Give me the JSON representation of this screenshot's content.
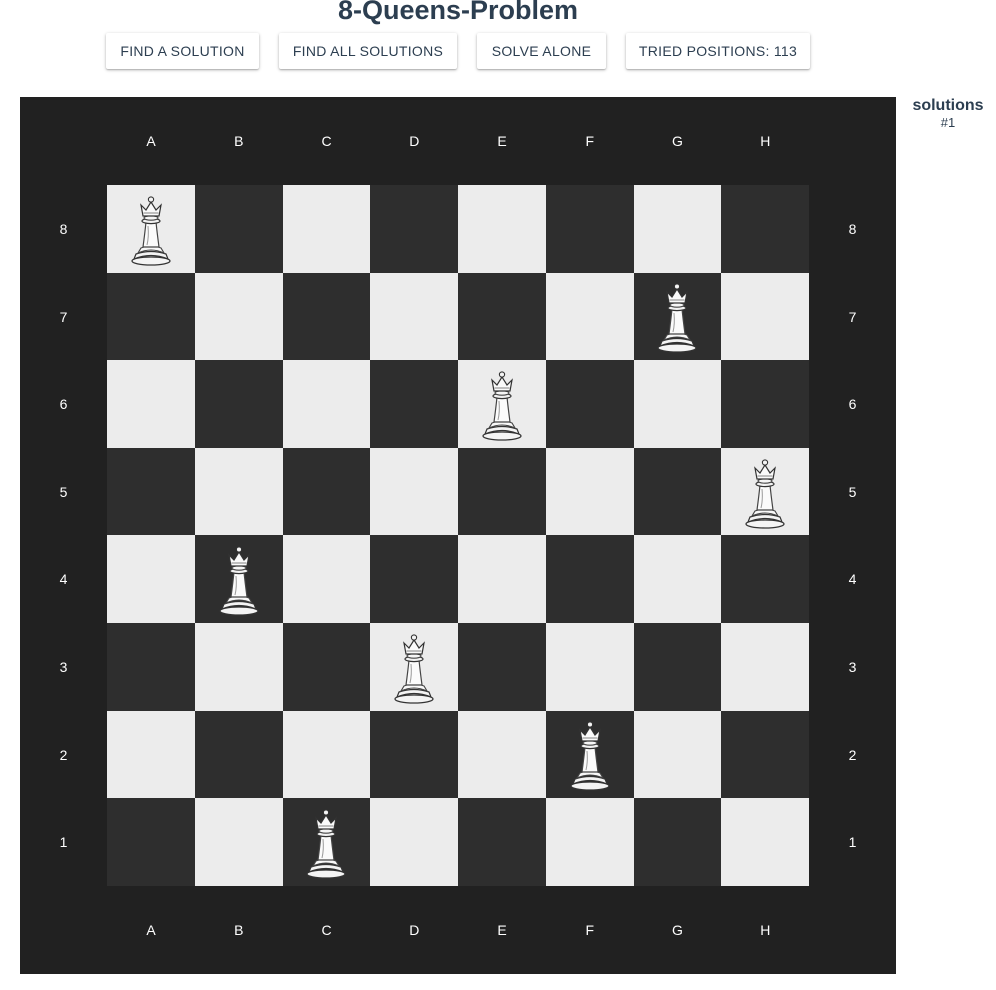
{
  "title": "8-Queens-Problem",
  "toolbar": {
    "find_solution_label": "FIND A SOLUTION",
    "find_all_label": "FIND ALL SOLUTIONS",
    "solve_alone_label": "SOLVE ALONE",
    "tried_positions_label": "TRIED POSITIONS: 113"
  },
  "board": {
    "files": [
      "A",
      "B",
      "C",
      "D",
      "E",
      "F",
      "G",
      "H"
    ],
    "ranks": [
      "8",
      "7",
      "6",
      "5",
      "4",
      "3",
      "2",
      "1"
    ],
    "queens": [
      {
        "file": "A",
        "rank": "8"
      },
      {
        "file": "G",
        "rank": "7"
      },
      {
        "file": "E",
        "rank": "6"
      },
      {
        "file": "H",
        "rank": "5"
      },
      {
        "file": "B",
        "rank": "4"
      },
      {
        "file": "D",
        "rank": "3"
      },
      {
        "file": "F",
        "rank": "2"
      },
      {
        "file": "C",
        "rank": "1"
      }
    ],
    "piece_icon": "white-queen-icon",
    "colors": {
      "frame": "#212121",
      "light_square": "#ececec",
      "dark_square": "#2e2e2e",
      "coordinate_text": "#ffffff"
    }
  },
  "solutions_panel": {
    "label": "solutions",
    "current": "#1"
  }
}
